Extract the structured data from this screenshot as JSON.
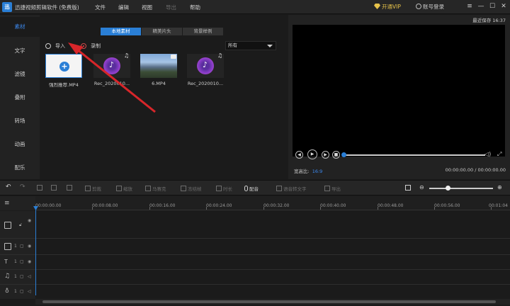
{
  "titlebar": {
    "logo_text": "迅",
    "title": "迅捷视频剪辑软件 (免费版)",
    "menus": [
      {
        "label": "文件",
        "enabled": true
      },
      {
        "label": "编辑",
        "enabled": true
      },
      {
        "label": "视图",
        "enabled": true
      },
      {
        "label": "导出",
        "enabled": false
      },
      {
        "label": "帮助",
        "enabled": true
      }
    ],
    "vip_label": "开通VIP",
    "login_label": "账号登录"
  },
  "sidebar": {
    "items": [
      "素材",
      "文字",
      "滤镜",
      "叠附",
      "转场",
      "动画",
      "配乐"
    ],
    "active_index": 0
  },
  "media": {
    "tabs": [
      "本地素材",
      "精美片头",
      "背景样例"
    ],
    "active_tab": 0,
    "import_label": "导入",
    "record_label": "录制",
    "filter_value": "所有",
    "clips": [
      {
        "name": "强烈推荐.MP4",
        "kind": "add"
      },
      {
        "name": "Rec_2020010...",
        "kind": "audio"
      },
      {
        "name": "6.MP4",
        "kind": "video"
      },
      {
        "name": "Rec_2020010...",
        "kind": "audio"
      }
    ]
  },
  "preview": {
    "last_saved": "最近保存 16:37",
    "aspect_label": "宽高比:",
    "aspect_value": "16:9",
    "timecode": "00:00:00.00 / 00:00:00.00",
    "seek_fraction": 0.0
  },
  "toolbar": {
    "items": [
      {
        "label": "剪裁",
        "enabled": false
      },
      {
        "label": "缩放",
        "enabled": false
      },
      {
        "label": "马赛克",
        "enabled": false
      },
      {
        "label": "冻结帧",
        "enabled": false
      },
      {
        "label": "时长",
        "enabled": false
      },
      {
        "label": "配音",
        "enabled": true
      },
      {
        "label": "语音转文字",
        "enabled": false
      },
      {
        "label": "导出",
        "enabled": false
      }
    ],
    "zoom_fraction": 0.3
  },
  "timeline": {
    "ticks": [
      "00:00:00.00",
      "00:00:08.00",
      "00:00:16.00",
      "00:00:24.00",
      "00:00:32.00",
      "00:00:40.00",
      "00:00:48.00",
      "00:00:56.00",
      "00:01:04"
    ],
    "track_numbers": [
      "1",
      "1",
      "1",
      "1"
    ]
  },
  "colors": {
    "accent": "#2a7fd6",
    "vip": "#e6c24a",
    "record": "#d24a4a",
    "background": "#1b1b1b"
  },
  "icons": [
    "undo-icon",
    "redo-icon",
    "split-icon",
    "delete-icon",
    "crop-icon",
    "zoom-icon",
    "mosaic-icon",
    "freeze-icon",
    "duration-icon",
    "mic-icon",
    "speech-icon",
    "export-icon",
    "play-icon",
    "prev-frame-icon",
    "next-frame-icon",
    "volume-icon",
    "fullscreen-icon",
    "track-list-icon",
    "lock-icon",
    "eye-icon"
  ]
}
